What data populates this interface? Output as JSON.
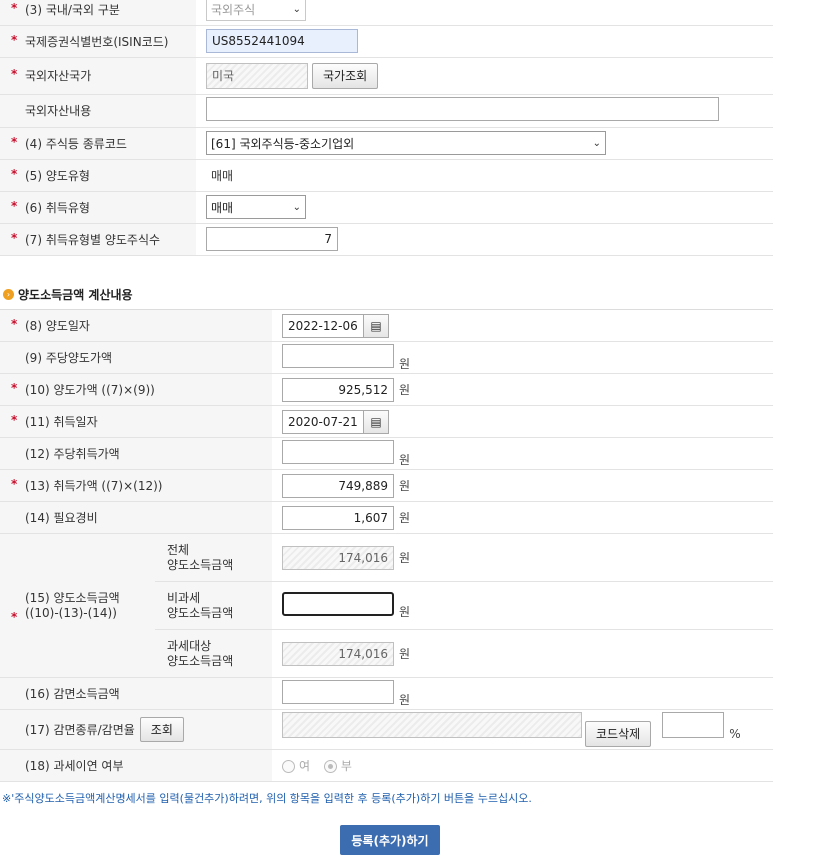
{
  "section1": {
    "rows": [
      {
        "label": "(3) 국내/국외 구분",
        "required": true
      },
      {
        "label": "국제증권식별번호(ISIN코드)",
        "required": true
      },
      {
        "label": "국외자산국가",
        "required": true
      },
      {
        "label": "국외자산내용",
        "required": false
      },
      {
        "label": "(4) 주식등 종류코드",
        "required": true
      },
      {
        "label": "(5) 양도유형",
        "required": true
      },
      {
        "label": "(6) 취득유형",
        "required": true
      },
      {
        "label": "(7) 취득유형별 양도주식수",
        "required": true
      }
    ],
    "domestic_select": "국외주식",
    "isin": "US8552441094",
    "country": "미국",
    "country_button": "국가조회",
    "asset_content": "",
    "stock_type": "[61] 국외주식등-중소기업외",
    "transfer_type": "매매",
    "acquisition_type": "매매",
    "shares": "7"
  },
  "section2": {
    "title": "양도소득금액 계산내용",
    "labels": {
      "r8": "(8) 양도일자",
      "r9": "(9) 주당양도가액",
      "r10": "(10) 양도가액 ((7)×(9))",
      "r11": "(11) 취득일자",
      "r12": "(12) 주당취득가액",
      "r13": "(13) 취득가액 ((7)×(12))",
      "r14": "(14) 필요경비",
      "r15a": "(15) 양도소득금액",
      "r15b": "((10)-(13)-(14))",
      "r16": "(16) 감면소득금액",
      "r17": "(17) 감면종류/감면율",
      "r18": "(18) 과세이연 여부"
    },
    "sub": {
      "total_a": "전체",
      "total_b": "양도소득금액",
      "nontax_a": "비과세",
      "nontax_b": "양도소득금액",
      "taxable_a": "과세대상",
      "taxable_b": "양도소득금액"
    },
    "values": {
      "transfer_date": "2022-12-06",
      "per_share_transfer": "",
      "transfer_amount": "925,512",
      "acq_date": "2020-07-21",
      "per_share_acq": "",
      "acq_amount": "749,889",
      "expenses": "1,607",
      "total_income": "174,016",
      "nontax_income": "",
      "taxable_income": "174,016",
      "reduction_income": "",
      "reduction_rate": ""
    },
    "unit": "원",
    "percent": "%",
    "lookup_button": "조회",
    "delete_code_button": "코드삭제",
    "radio_yes": "여",
    "radio_no": "부"
  },
  "notice": "※'주식양도소득금액계산명세서를 입력(물건추가)하려면, 위의 항목을 입력한 후 등록(추가)하기 버튼을 누르십시오.",
  "submit_button": "등록(추가)하기",
  "colors": {
    "required": "#c8102e",
    "notice": "#1f5fae",
    "submit_bg": "#3b6db0",
    "section_icon": "#f0a020"
  }
}
